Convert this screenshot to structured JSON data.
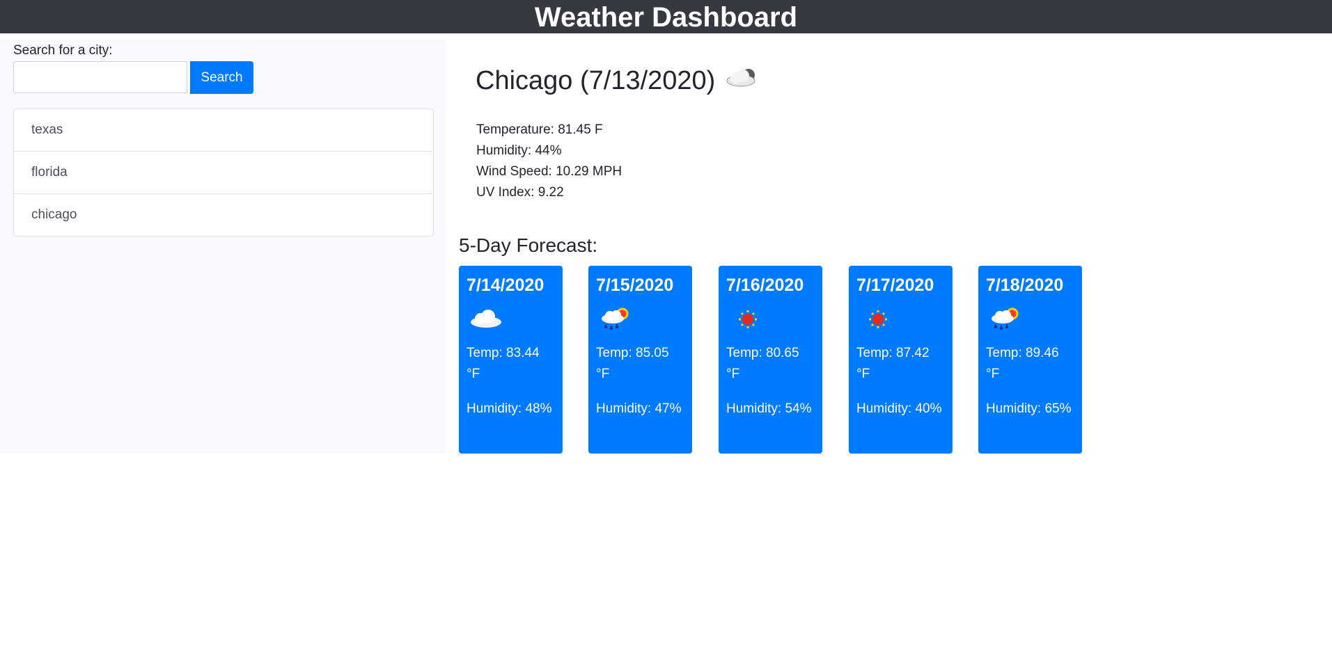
{
  "header": {
    "title": "Weather Dashboard"
  },
  "search": {
    "label": "Search for a city:",
    "value": "",
    "placeholder": "",
    "button_label": "Search"
  },
  "history": [
    "texas",
    "florida",
    "chicago"
  ],
  "current": {
    "title": "Chicago (7/13/2020)",
    "icon": "cloud-icon",
    "temperature": "Temperature: 81.45 F",
    "humidity": "Humidity: 44%",
    "wind": "Wind Speed: 10.29 MPH",
    "uv": "UV Index: 9.22"
  },
  "forecast": {
    "heading": "5-Day Forecast:",
    "days": [
      {
        "date": "7/14/2020",
        "icon": "cloud-icon",
        "temp": "Temp: 83.44 °F",
        "humidity": "Humidity: 48%"
      },
      {
        "date": "7/15/2020",
        "icon": "rain-sun-icon",
        "temp": "Temp: 85.05 °F",
        "humidity": "Humidity: 47%"
      },
      {
        "date": "7/16/2020",
        "icon": "sun-icon",
        "temp": "Temp: 80.65 °F",
        "humidity": "Humidity: 54%"
      },
      {
        "date": "7/17/2020",
        "icon": "sun-icon",
        "temp": "Temp: 87.42 °F",
        "humidity": "Humidity: 40%"
      },
      {
        "date": "7/18/2020",
        "icon": "rain-sun-icon",
        "temp": "Temp: 89.46 °F",
        "humidity": "Humidity: 65%"
      }
    ]
  },
  "colors": {
    "header_bg": "#343a40",
    "accent": "#007bff",
    "sidebar_bg": "#f8f9fa"
  }
}
